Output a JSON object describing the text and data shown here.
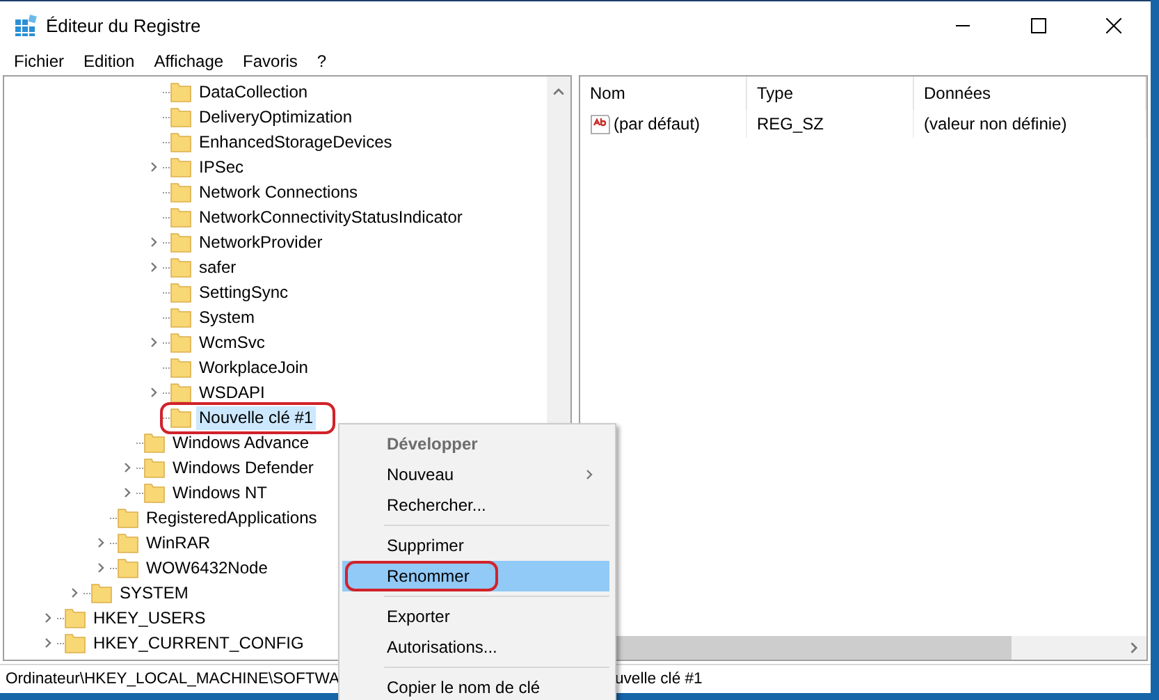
{
  "window": {
    "title": "Éditeur du Registre"
  },
  "menu_bar": [
    "Fichier",
    "Edition",
    "Affichage",
    "Favoris",
    "?"
  ],
  "tree": [
    {
      "children": [
        {
          "children": [
            {
              "children": [
                {
                  "children": [
                    {
                      "label": "DataCollection",
                      "expandable": false,
                      "selected": false,
                      "circled": false
                    },
                    {
                      "label": "DeliveryOptimization",
                      "expandable": false,
                      "selected": false,
                      "circled": false
                    },
                    {
                      "label": "EnhancedStorageDevices",
                      "expandable": false,
                      "selected": false,
                      "circled": false
                    },
                    {
                      "label": "IPSec",
                      "expandable": true,
                      "selected": false,
                      "circled": false
                    },
                    {
                      "label": "Network Connections",
                      "expandable": false,
                      "selected": false,
                      "circled": false
                    },
                    {
                      "label": "NetworkConnectivityStatusIndicator",
                      "expandable": false,
                      "selected": false,
                      "circled": false
                    },
                    {
                      "label": "NetworkProvider",
                      "expandable": true,
                      "selected": false,
                      "circled": false
                    },
                    {
                      "label": "safer",
                      "expandable": true,
                      "selected": false,
                      "circled": false
                    },
                    {
                      "label": "SettingSync",
                      "expandable": false,
                      "selected": false,
                      "circled": false
                    },
                    {
                      "label": "System",
                      "expandable": false,
                      "selected": false,
                      "circled": false
                    },
                    {
                      "label": "WcmSvc",
                      "expandable": true,
                      "selected": false,
                      "circled": false
                    },
                    {
                      "label": "WorkplaceJoin",
                      "expandable": false,
                      "selected": false,
                      "circled": false
                    },
                    {
                      "label": "WSDAPI",
                      "expandable": true,
                      "selected": false,
                      "circled": false
                    },
                    {
                      "label": "Nouvelle clé #1",
                      "expandable": false,
                      "selected": true,
                      "circled": true
                    }
                  ]
                },
                {
                  "label": "Windows Advance",
                  "expandable": false,
                  "selected": false,
                  "circled": false
                },
                {
                  "label": "Windows Defender",
                  "expandable": true,
                  "selected": false,
                  "circled": false
                },
                {
                  "label": "Windows NT",
                  "expandable": true,
                  "selected": false,
                  "circled": false
                }
              ]
            },
            {
              "label": "RegisteredApplications",
              "expandable": false,
              "selected": false,
              "circled": false
            },
            {
              "label": "WinRAR",
              "expandable": true,
              "selected": false,
              "circled": false
            },
            {
              "label": "WOW6432Node",
              "expandable": true,
              "selected": false,
              "circled": false
            }
          ]
        },
        {
          "label": "SYSTEM",
          "expandable": true,
          "selected": false,
          "circled": false
        }
      ]
    },
    {
      "label": "HKEY_USERS",
      "expandable": true,
      "selected": false,
      "circled": false
    },
    {
      "label": "HKEY_CURRENT_CONFIG",
      "expandable": true,
      "selected": false,
      "circled": false
    }
  ],
  "values": {
    "columns": [
      "Nom",
      "Type",
      "Données"
    ],
    "rows": [
      {
        "name": "(par défaut)",
        "type": "REG_SZ",
        "data": "(valeur non définie)"
      }
    ]
  },
  "context_menu": [
    {
      "kind": "item",
      "label": "Développer",
      "bold": true,
      "submenu": false,
      "selected": false,
      "circled": false
    },
    {
      "kind": "item",
      "label": "Nouveau",
      "bold": false,
      "submenu": true,
      "selected": false,
      "circled": false
    },
    {
      "kind": "item",
      "label": "Rechercher...",
      "bold": false,
      "submenu": false,
      "selected": false,
      "circled": false
    },
    {
      "kind": "separator"
    },
    {
      "kind": "item",
      "label": "Supprimer",
      "bold": false,
      "submenu": false,
      "selected": false,
      "circled": false
    },
    {
      "kind": "item",
      "label": "Renommer",
      "bold": false,
      "submenu": false,
      "selected": true,
      "circled": true
    },
    {
      "kind": "separator"
    },
    {
      "kind": "item",
      "label": "Exporter",
      "bold": false,
      "submenu": false,
      "selected": false,
      "circled": false
    },
    {
      "kind": "item",
      "label": "Autorisations...",
      "bold": false,
      "submenu": false,
      "selected": false,
      "circled": false
    },
    {
      "kind": "separator"
    },
    {
      "kind": "item",
      "label": "Copier le nom de clé",
      "bold": false,
      "submenu": false,
      "selected": false,
      "circled": false
    }
  ],
  "status_bar": {
    "path_start": "Ordinateur\\HKEY_LOCAL_MACHINE\\SOFTWA",
    "path_end": "uvelle clé #1"
  }
}
